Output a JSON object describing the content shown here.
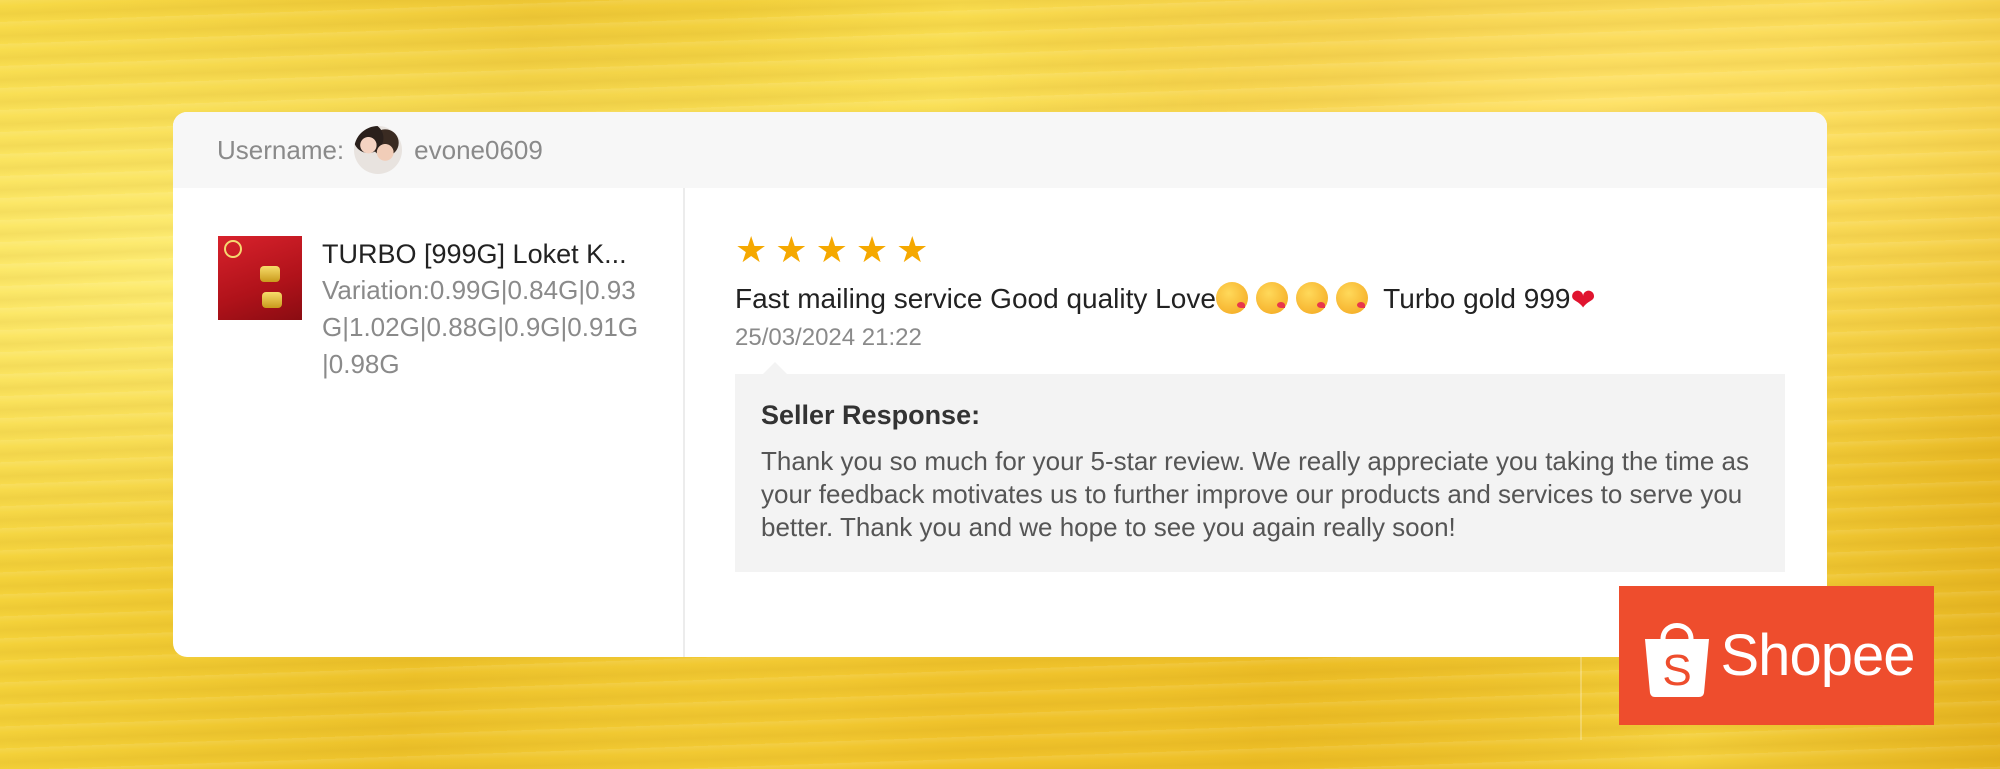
{
  "header": {
    "username_label": "Username:",
    "username": "evone0609"
  },
  "product": {
    "title": "TURBO [999G] Loket K...",
    "variation": "Variation:0.99G|0.84G|0.93G|1.02G|0.88G|0.9G|0.91G|0.98G"
  },
  "review": {
    "rating": 5,
    "rating_max": 5,
    "star_color": "#f5a800",
    "text_part1": "Fast mailing service Good quality Love",
    "text_part2": " Turbo gold 999",
    "emoji_icons": [
      "kissing-face-emoji",
      "kissing-face-emoji",
      "kissing-face-emoji",
      "kissing-face-emoji"
    ],
    "end_icon": "red-heart-emoji",
    "date": "25/03/2024 21:22"
  },
  "seller_response": {
    "title": "Seller Response:",
    "text": "Thank you so much for your 5-star review. We really appreciate you taking the time as your feedback motivates us to further improve our products and services to serve you better. Thank you and we hope to see you again really soon!"
  },
  "brand": {
    "name": "Shopee",
    "color": "#ee4d2d"
  }
}
